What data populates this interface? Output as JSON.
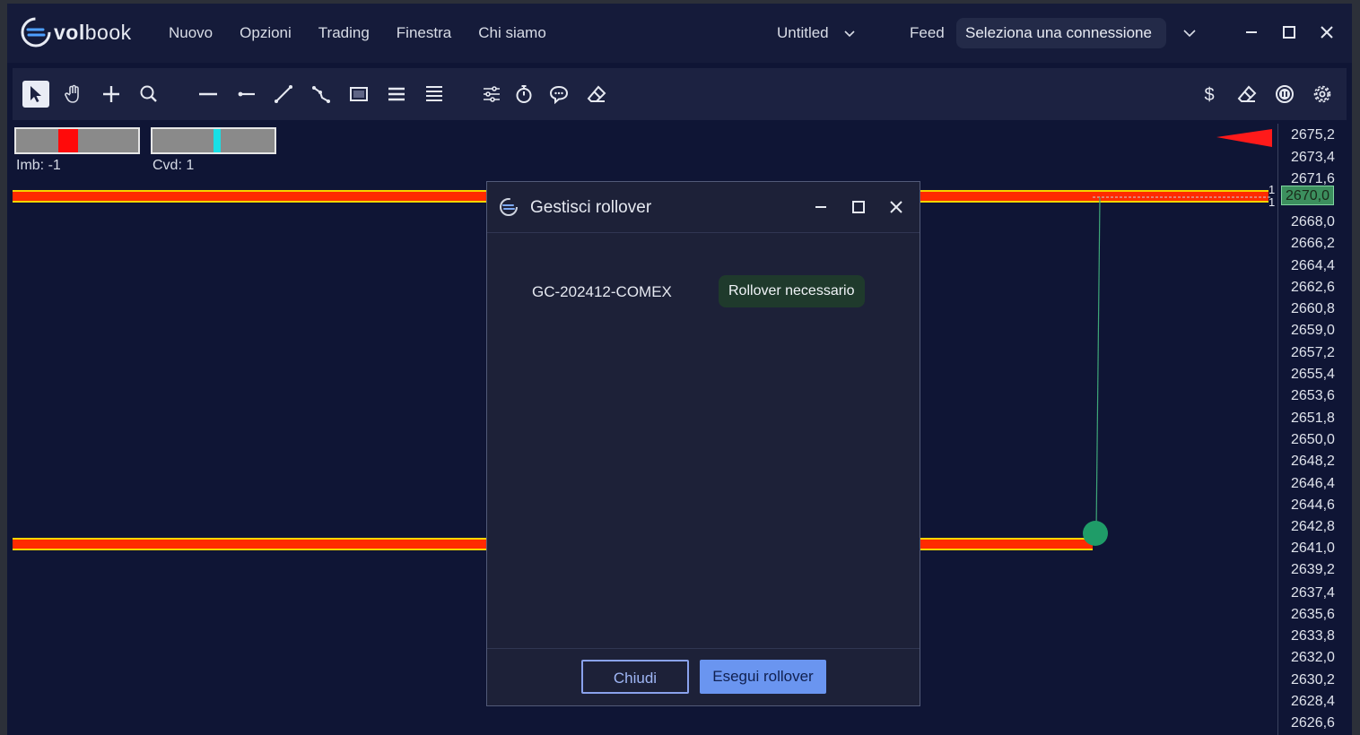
{
  "app": {
    "logo_bold": "vol",
    "logo_light": "book"
  },
  "menu": {
    "items": [
      "Nuovo",
      "Opzioni",
      "Trading",
      "Finestra",
      "Chi siamo"
    ]
  },
  "document": {
    "name": "Untitled"
  },
  "feed": {
    "label": "Feed",
    "connection_placeholder": "Seleziona una connessione"
  },
  "toolbar": {
    "left_tools": [
      "pointer-icon",
      "hand-icon",
      "crosshair-icon",
      "zoom-icon",
      "horizontal-line-icon",
      "ray-icon",
      "trend-line-icon",
      "path-icon",
      "rectangle-icon",
      "lines-icon",
      "multi-lines-icon",
      "sliders-icon",
      "timer-icon",
      "comment-icon",
      "eraser-icon"
    ],
    "right_tools": [
      "dollar-icon",
      "eraser-icon",
      "pause-icon",
      "settings-icon"
    ]
  },
  "indicators": {
    "imbalance_label": "Imb: -1",
    "cvd_label": "Cvd: 1"
  },
  "price_axis": {
    "ticks": [
      "2675,2",
      "2673,4",
      "2671,6",
      "2670,0",
      "2668,0",
      "2666,2",
      "2664,4",
      "2662,6",
      "2660,8",
      "2659,0",
      "2657,2",
      "2655,4",
      "2653,6",
      "2651,8",
      "2650,0",
      "2648,2",
      "2646,4",
      "2644,6",
      "2642,8",
      "2641,0",
      "2639,2",
      "2637,4",
      "2635,6",
      "2633,8",
      "2632,0",
      "2630,2",
      "2628,4",
      "2626,6"
    ],
    "current_price": "2670,0",
    "order_qty_top": "1",
    "order_qty_bottom": "1"
  },
  "modal": {
    "title": "Gestisci rollover",
    "contract": "GC-202412-COMEX",
    "status": "Rollover necessario",
    "close_button": "Chiudi",
    "execute_button": "Esegui rollover"
  },
  "colors": {
    "background": "#0f1535",
    "level_fill": "#ff2a00",
    "level_border": "#f5d400",
    "accent": "#6a95f0",
    "marker": "#1f9c68"
  }
}
